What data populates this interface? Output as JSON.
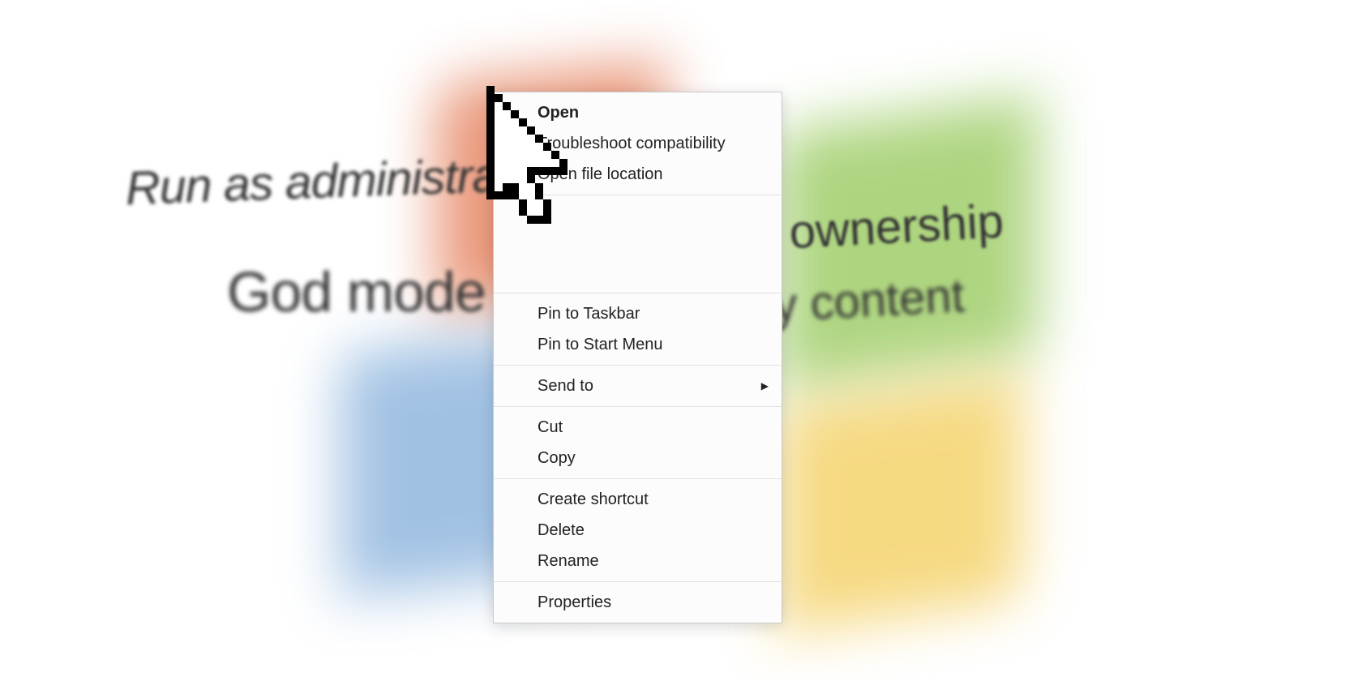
{
  "background_phrases": {
    "run_admin": "Run as administrator",
    "god_mode": "God mode",
    "take_ownership": "Take ownership",
    "copy_content": "Copy content"
  },
  "context_menu": {
    "sections": [
      {
        "items": [
          {
            "label": "Open",
            "bold": true
          },
          {
            "label": "Troubleshoot compatibility"
          },
          {
            "label": "Open file location"
          }
        ]
      },
      {
        "items": [
          {
            "blank": true
          },
          {
            "blank": true
          },
          {
            "blank": true
          }
        ]
      },
      {
        "items": [
          {
            "label": "Pin to Taskbar"
          },
          {
            "label": "Pin to Start Menu"
          }
        ]
      },
      {
        "items": [
          {
            "label": "Send to",
            "submenu": true
          }
        ]
      },
      {
        "items": [
          {
            "label": "Cut"
          },
          {
            "label": "Copy"
          }
        ]
      },
      {
        "items": [
          {
            "label": "Create shortcut"
          },
          {
            "label": "Delete"
          },
          {
            "label": "Rename"
          }
        ]
      },
      {
        "items": [
          {
            "label": "Properties"
          }
        ]
      }
    ]
  }
}
